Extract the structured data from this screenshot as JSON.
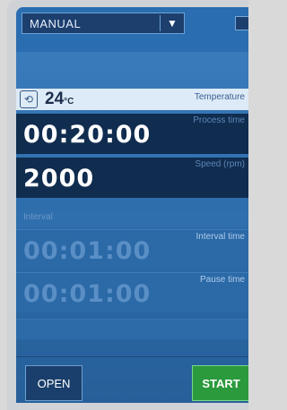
{
  "header": {
    "mode_selected": "MANUAL"
  },
  "temperature": {
    "value": "24",
    "unit": "°C",
    "label": "Temperature"
  },
  "process_time": {
    "label": "Process time",
    "value": "00:20:00"
  },
  "speed": {
    "label": "Speed (rpm)",
    "value": "2000"
  },
  "interval": {
    "header": "Interval",
    "interval_time_label": "Interval time",
    "interval_time_value": "00:01:00",
    "pause_time_label": "Pause time",
    "pause_time_value": "00:01:00"
  },
  "buttons": {
    "open": "OPEN",
    "start": "START"
  }
}
